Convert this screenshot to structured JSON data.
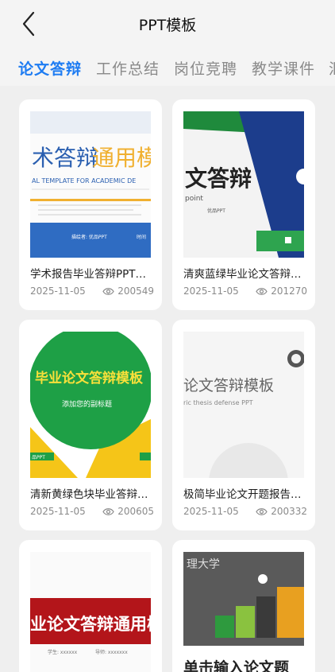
{
  "header": {
    "title": "PPT模板"
  },
  "tabs": [
    "论文答辩",
    "工作总结",
    "岗位竞聘",
    "教学课件",
    "汇"
  ],
  "cards": [
    {
      "title": "学术报告毕业答辩PPT模板",
      "date": "2025-11-05",
      "views": "200549",
      "thumb_text": {
        "main": "术答辩",
        "accent": "通用模",
        "sub": "AL TEMPLATE FOR ACADEMIC DE",
        "footer_a": "描绘者: 优品PPT",
        "footer_b": "时间"
      }
    },
    {
      "title": "清爽蓝绿毕业论文答辩PPT模板",
      "date": "2025-11-05",
      "views": "201270",
      "thumb_text": {
        "main": "文答辩",
        "sub": "point",
        "sub2": "优品PPT"
      }
    },
    {
      "title": "清新黄绿色块毕业答辩PPT模板",
      "date": "2025-11-05",
      "views": "200605",
      "thumb_text": {
        "main": "毕业论文答辩模板",
        "sub": "添加您的副标题",
        "footer": "品PPT"
      }
    },
    {
      "title": "极简毕业论文开题报告PPT模板",
      "date": "2025-11-05",
      "views": "200332",
      "thumb_text": {
        "main": "论文答辩模板",
        "sub": "ric thesis defense PPT"
      }
    },
    {
      "title": "",
      "date": "",
      "views": "",
      "thumb_text": {
        "main": "业论文答辩通用模",
        "sub_a": "学生: xxxxxx",
        "sub_b": "导师: xxxxxxx"
      }
    },
    {
      "title": "",
      "date": "",
      "views": "",
      "thumb_text": {
        "logo": "理大学",
        "main": "单击输入论文题"
      }
    }
  ],
  "colors": {
    "accent": "#1e7cf2",
    "background": "#efefef",
    "muted": "#8a8a8a"
  }
}
